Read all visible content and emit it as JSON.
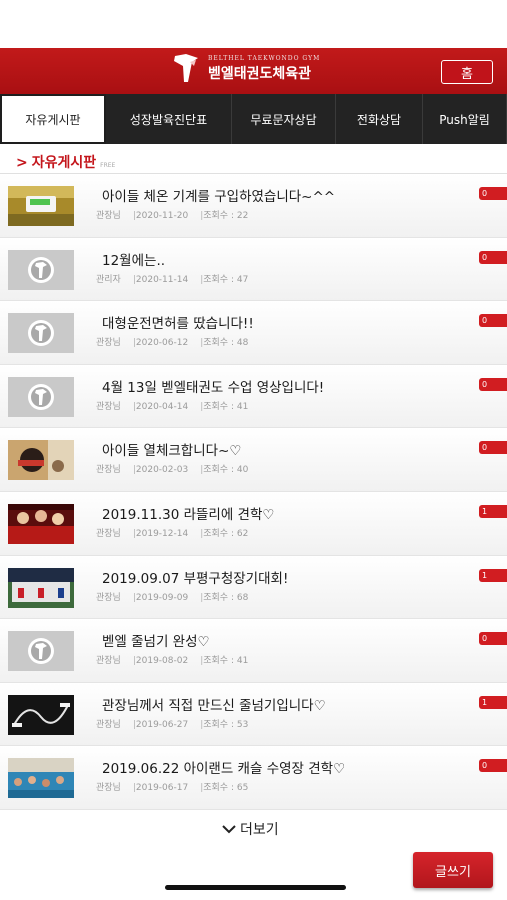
{
  "header": {
    "logo_sub": "BELTHEL TAEKWONDO GYM",
    "logo_title": "벧엘태권도체육관",
    "home_label": "홈"
  },
  "tabs": [
    {
      "label": "자유게시판",
      "active": true
    },
    {
      "label": "성장발육진단표",
      "active": false
    },
    {
      "label": "무료문자상담",
      "active": false
    },
    {
      "label": "전화상담",
      "active": false
    },
    {
      "label": "Push알림",
      "active": false
    }
  ],
  "section": {
    "title": "자유게시판",
    "sub": "FREE"
  },
  "posts": [
    {
      "title": "아이들 체온 기계를 구입하였습니다~^^",
      "author": "관장님",
      "date": "2020-11-20",
      "views": "조회수 : 22",
      "badge": "0",
      "thumb": "photo-thermometer"
    },
    {
      "title": "12월에는..",
      "author": "관리자",
      "date": "2020-11-14",
      "views": "조회수 : 47",
      "badge": "0",
      "thumb": "logo"
    },
    {
      "title": "대형운전면허를 땄습니다!!",
      "author": "관장님",
      "date": "2020-06-12",
      "views": "조회수 : 48",
      "badge": "0",
      "thumb": "logo"
    },
    {
      "title": "4월 13일 벧엘태권도 수업 영상입니다!",
      "author": "관장님",
      "date": "2020-04-14",
      "views": "조회수 : 41",
      "badge": "0",
      "thumb": "logo"
    },
    {
      "title": "아이들 열체크합니다~♡",
      "author": "관장님",
      "date": "2020-02-03",
      "views": "조회수 : 40",
      "badge": "0",
      "thumb": "photo-check"
    },
    {
      "title": "2019.11.30 라뜰리에 견학♡",
      "author": "관장님",
      "date": "2019-12-14",
      "views": "조회수 : 62",
      "badge": "1",
      "thumb": "photo-red"
    },
    {
      "title": "2019.09.07 부평구청장기대회!",
      "author": "관장님",
      "date": "2019-09-09",
      "views": "조회수 : 68",
      "badge": "1",
      "thumb": "photo-group"
    },
    {
      "title": "벧엘 줄넘기 완성♡",
      "author": "관장님",
      "date": "2019-08-02",
      "views": "조회수 : 41",
      "badge": "0",
      "thumb": "logo"
    },
    {
      "title": "관장님께서 직접 만드신 줄넘기입니다♡",
      "author": "관장님",
      "date": "2019-06-27",
      "views": "조회수 : 53",
      "badge": "1",
      "thumb": "photo-rope"
    },
    {
      "title": "2019.06.22 아이랜드 캐슬 수영장 견학♡",
      "author": "관장님",
      "date": "2019-06-17",
      "views": "조회수 : 65",
      "badge": "0",
      "thumb": "photo-pool"
    }
  ],
  "more_label": "더보기",
  "write_label": "글쓰기",
  "colors": {
    "brand_red": "#c4161c",
    "tab_bg": "#232323"
  }
}
